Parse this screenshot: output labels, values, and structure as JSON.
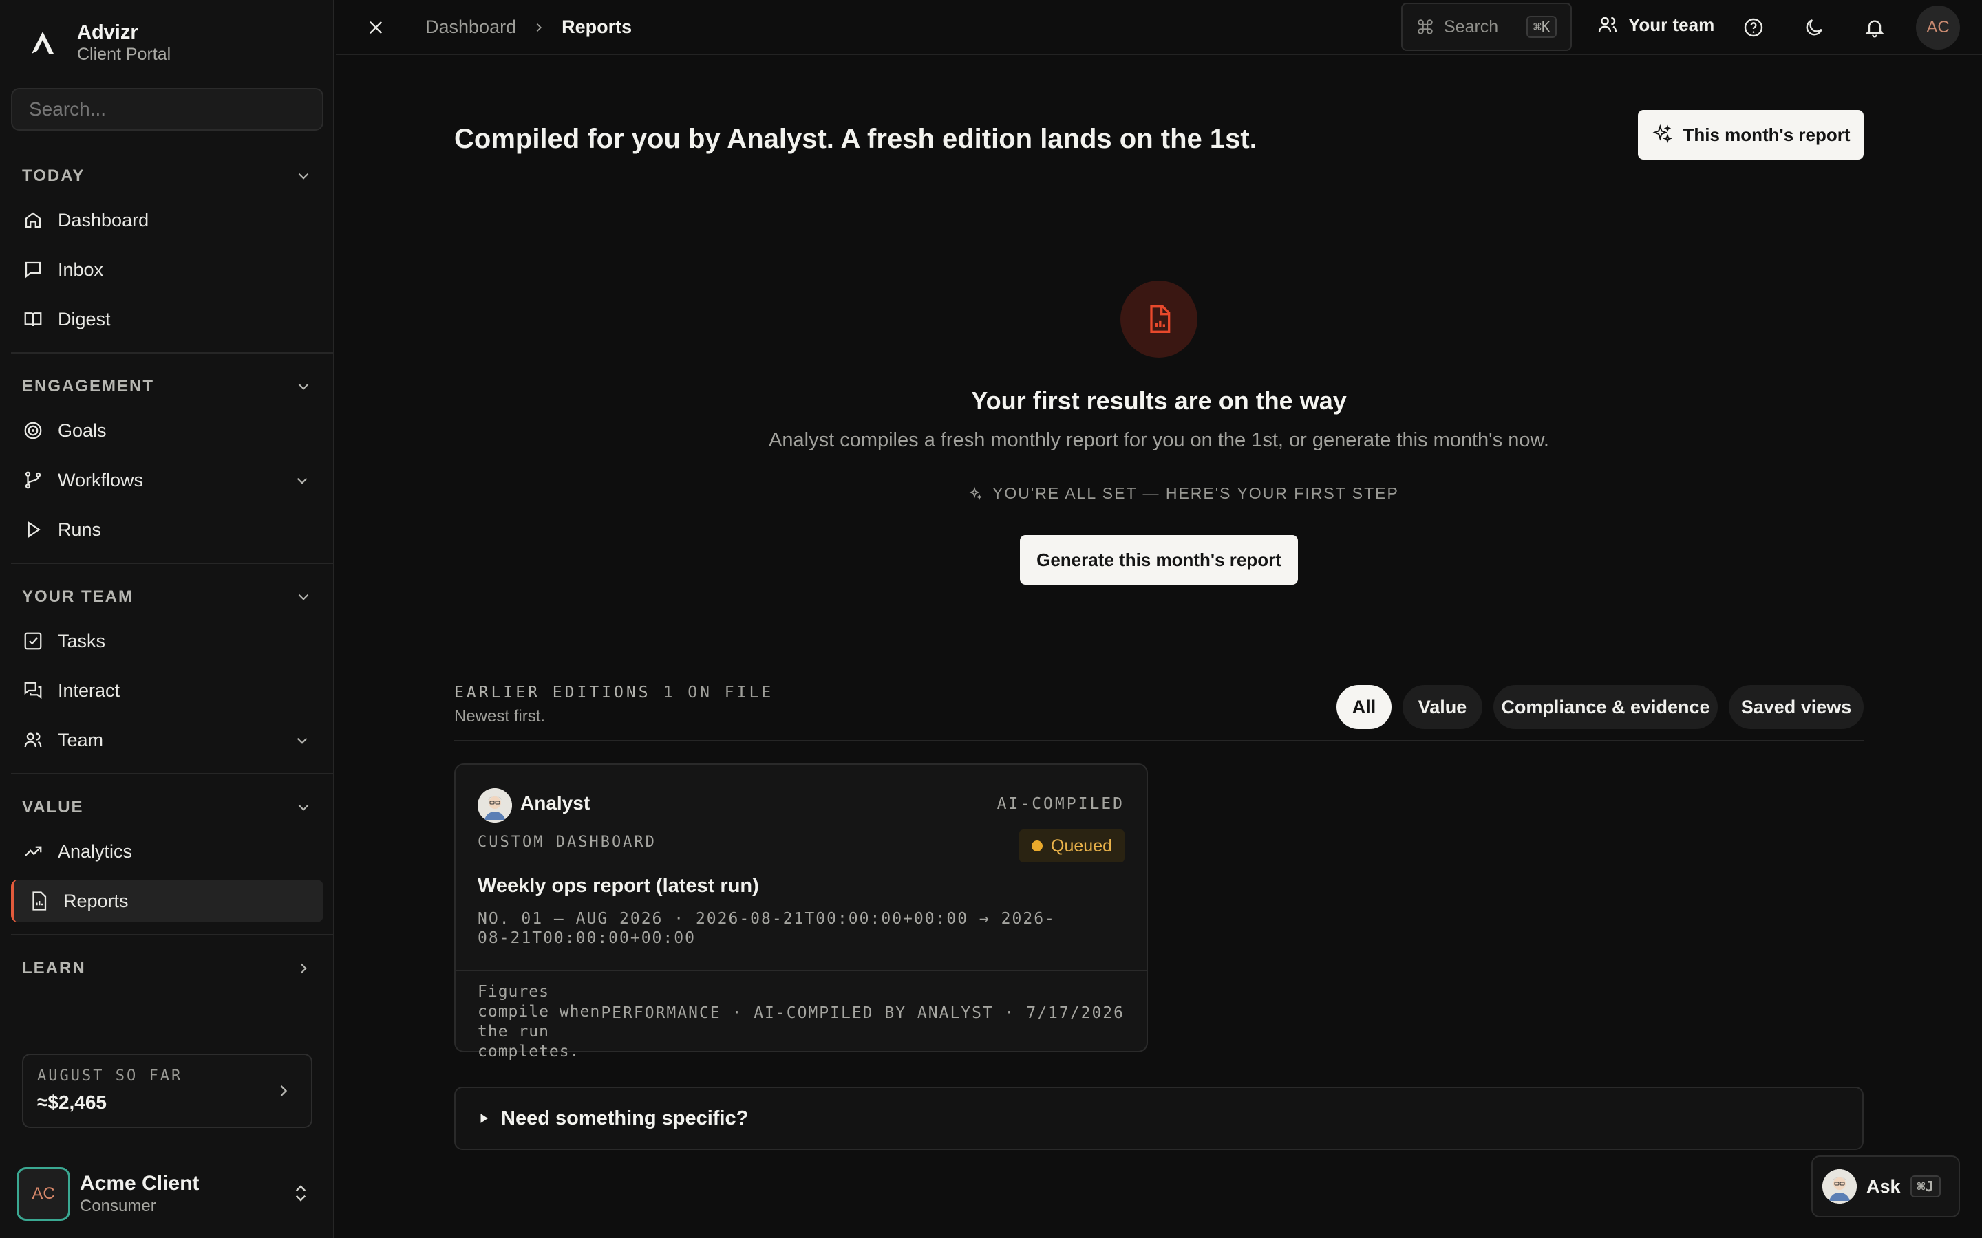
{
  "brand": {
    "name": "Advizr",
    "subtitle": "Client Portal"
  },
  "sidebar": {
    "search_placeholder": "Search...",
    "sections": {
      "today": "TODAY",
      "engagement": "ENGAGEMENT",
      "your_team": "YOUR TEAM",
      "value": "VALUE",
      "learn": "LEARN"
    },
    "items": {
      "dashboard": "Dashboard",
      "inbox": "Inbox",
      "digest": "Digest",
      "goals": "Goals",
      "workflows": "Workflows",
      "runs": "Runs",
      "tasks": "Tasks",
      "interact": "Interact",
      "team": "Team",
      "analytics": "Analytics",
      "reports": "Reports"
    },
    "month_card": {
      "label": "AUGUST SO FAR",
      "value": "≈$2,465"
    },
    "user": {
      "initials": "AC",
      "name": "Acme Client",
      "role": "Consumer"
    }
  },
  "topbar": {
    "breadcrumb": [
      "Dashboard",
      "Reports"
    ],
    "search_label": "Search",
    "search_shortcut": "⌘K",
    "team_label": "Your team",
    "avatar_initials": "AC"
  },
  "main": {
    "headline": "Compiled for you by Analyst. A fresh edition lands on the 1st.",
    "month_report_button": "This month's report",
    "empty": {
      "title": "Your first results are on the way",
      "subtitle": "Analyst compiles a fresh monthly report for you on the 1st, or generate this month's now.",
      "first_step": "YOU'RE ALL SET — HERE'S YOUR FIRST STEP",
      "generate_button": "Generate this month's report"
    },
    "earlier": {
      "label": "EARLIER EDITIONS",
      "count": "1 ON FILE",
      "subtitle": "Newest first.",
      "filters": [
        "All",
        "Value",
        "Compliance & evidence",
        "Saved views"
      ]
    },
    "edition": {
      "author": "Analyst",
      "tag": "AI-COMPILED",
      "kind": "CUSTOM DASHBOARD",
      "status": "Queued",
      "title": "Weekly ops report (latest run)",
      "meta": "NO. 01 — AUG 2026 · 2026-08-21T00:00:00+00:00 → 2026-08-21T00:00:00+00:00",
      "footer_left": "Figures compile when the run completes.",
      "footer_right": "PERFORMANCE · AI-COMPILED BY ANALYST · 7/17/2026"
    },
    "specific_label": "Need something specific?",
    "ask": {
      "label": "Ask",
      "shortcut": "⌘J"
    }
  },
  "colors": {
    "accent": "#e25b3c",
    "status_queued": "#e9a92c",
    "avatar_ring": "#3aa892"
  }
}
